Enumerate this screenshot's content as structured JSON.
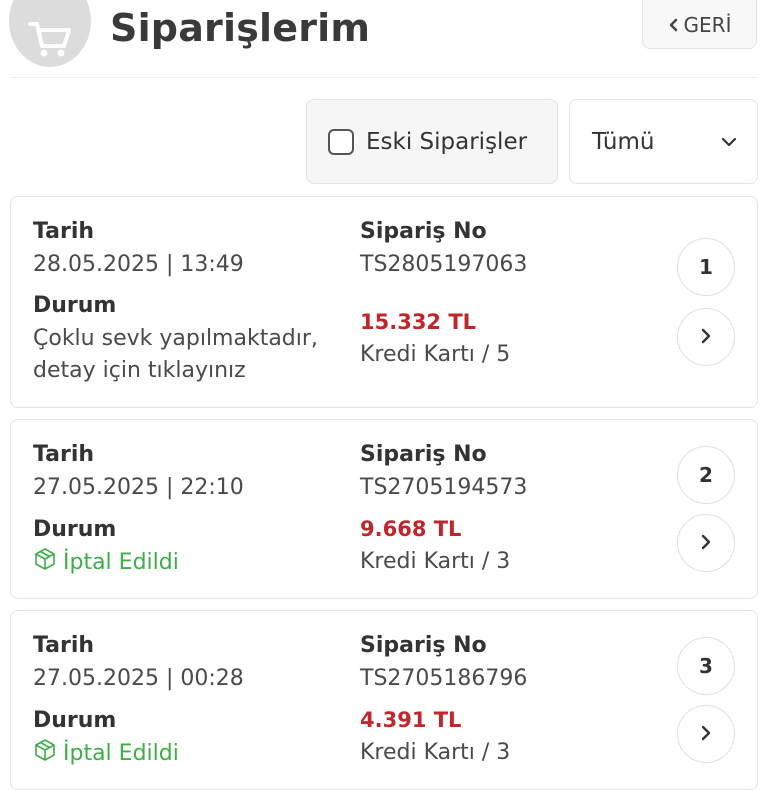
{
  "header": {
    "title": "Siparişlerim",
    "back_label": "GERİ",
    "cart_icon": "cart-icon"
  },
  "filters": {
    "old_orders_label": "Eski Siparişler",
    "old_orders_checked": false,
    "status_select_value": "Tümü"
  },
  "orders": [
    {
      "date_label": "Tarih",
      "date": "28.05.2025 | 13:49",
      "order_no_label": "Sipariş No",
      "order_no": "TS2805197063",
      "status_label": "Durum",
      "status_line1": "Çoklu sevk yapılmaktadır,",
      "status_line2": "detay için tıklayınız",
      "amount": "15.332 TL",
      "payment": "Kredi Kartı / 5",
      "index": "1"
    },
    {
      "date_label": "Tarih",
      "date": "27.05.2025 | 22:10",
      "order_no_label": "Sipariş No",
      "order_no": "TS2705194573",
      "status_label": "Durum",
      "status": "İptal Edildi",
      "amount": "9.668 TL",
      "payment": "Kredi Kartı / 3",
      "index": "2"
    },
    {
      "date_label": "Tarih",
      "date": "27.05.2025 | 00:28",
      "order_no_label": "Sipariş No",
      "order_no": "TS2705186796",
      "status_label": "Durum",
      "status": "İptal Edildi",
      "amount": "4.391 TL",
      "payment": "Kredi Kartı / 3",
      "index": "3"
    }
  ],
  "colors": {
    "price": "#c0272d",
    "cancelled": "#3fae49"
  }
}
